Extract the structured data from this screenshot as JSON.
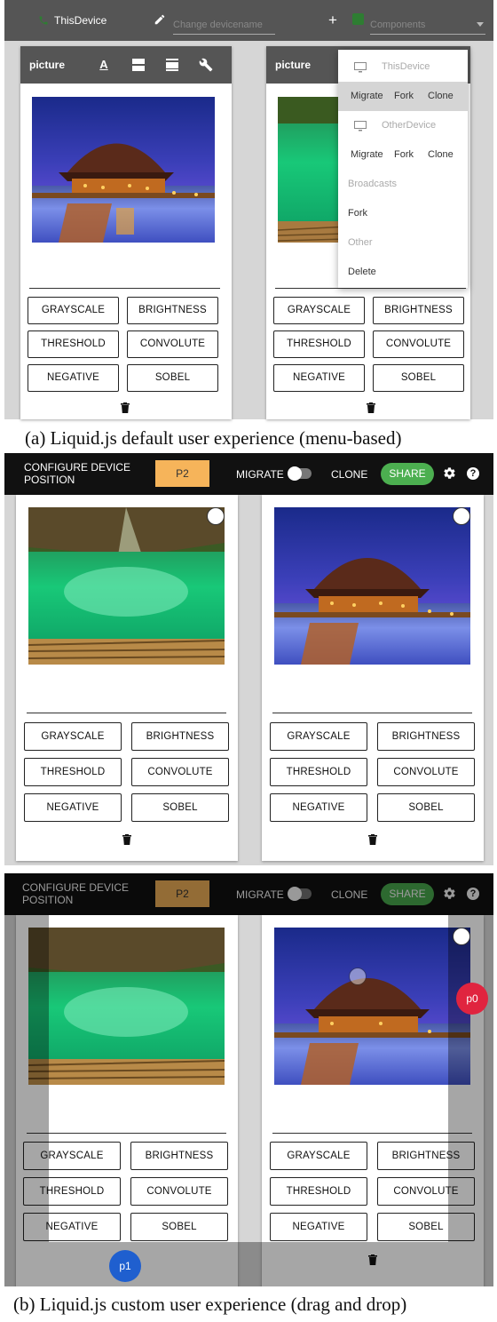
{
  "section_a": {
    "topbar": {
      "device_name": "ThisDevice",
      "device_name_placeholder": "Change devicename",
      "add_symbol": "+",
      "components_label": "Components"
    },
    "left_card": {
      "title": "picture",
      "header_icons": [
        "text-format-icon",
        "view-agenda-icon",
        "view-day-icon",
        "wrench-icon"
      ]
    },
    "right_card": {
      "title": "picture"
    },
    "filter_buttons": [
      "GRAYSCALE",
      "BRIGHTNESS",
      "THRESHOLD",
      "CONVOLUTE",
      "NEGATIVE",
      "SOBEL"
    ],
    "menu": {
      "this_device": "ThisDevice",
      "this_device_actions": [
        "Migrate",
        "Fork",
        "Clone"
      ],
      "other_device": "OtherDevice",
      "other_device_actions": [
        "Migrate",
        "Fork",
        "Clone"
      ],
      "broadcasts_label": "Broadcasts",
      "broadcast_action": "Fork",
      "other_label": "Other",
      "other_action": "Delete"
    },
    "caption": "(a) Liquid.js default user experience (menu-based)"
  },
  "section_b": {
    "topbar": {
      "configure_label_1": "CONFIGURE DEVICE",
      "configure_label_2": "POSITION",
      "position_button": "P2",
      "migrate_label": "MIGRATE",
      "clone_label": "CLONE",
      "share_button": "SHARE"
    },
    "filter_buttons": [
      "GRAYSCALE",
      "BRIGHTNESS",
      "THRESHOLD",
      "CONVOLUTE",
      "NEGATIVE",
      "SOBEL"
    ],
    "markers": {
      "p0": "p0",
      "p1": "p1"
    },
    "caption": "(b) Liquid.js custom user experience (drag and drop)"
  },
  "colors": {
    "dark_bar": "#555555",
    "black_bar": "#111111",
    "position_orange": "#f6b45a",
    "share_green": "#4caf50",
    "marker_red": "#e0243f",
    "marker_blue": "#1f5fcf"
  }
}
